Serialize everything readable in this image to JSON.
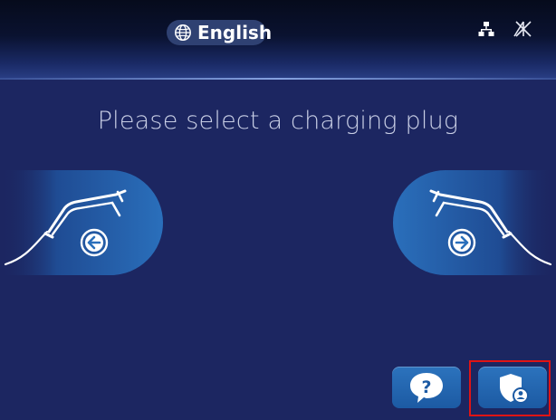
{
  "header": {
    "language_label": "English",
    "language_icon": "globe-icon",
    "status_icons": [
      "network-icon",
      "no-signal-icon"
    ]
  },
  "main": {
    "title": "Please select a charging plug"
  },
  "plugs": [
    {
      "side": "left",
      "arrow": "arrow-left-icon",
      "icon": "charging-plug-icon"
    },
    {
      "side": "right",
      "arrow": "arrow-right-icon",
      "icon": "charging-plug-icon"
    }
  ],
  "footer": {
    "help_icon": "question-mark-icon",
    "admin_icon": "shield-user-icon"
  },
  "colors": {
    "background": "#1c2661",
    "header": "#0a1230",
    "button": "#2266ad",
    "plug_panel": "#2468b2",
    "highlight": "#e01414",
    "title_text": "#c9cfe6"
  }
}
